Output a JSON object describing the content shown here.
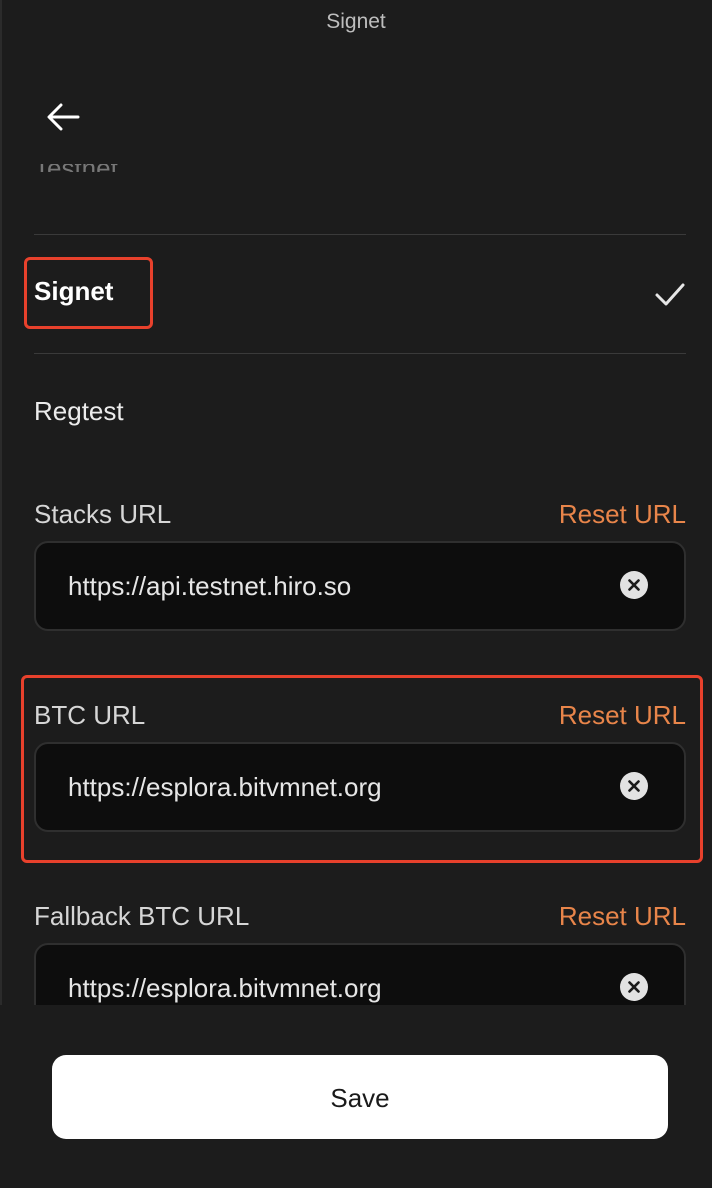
{
  "header": {
    "title": "Signet"
  },
  "icons": {
    "back": "arrow-left-icon",
    "check": "check-icon",
    "clear": "close-circle-icon"
  },
  "networks": {
    "hidden_label": "Testnet",
    "items": [
      {
        "label": "Signet",
        "selected": true
      },
      {
        "label": "Regtest",
        "selected": false
      }
    ]
  },
  "fields": [
    {
      "label": "Stacks URL",
      "reset_label": "Reset URL",
      "value": "https://api.testnet.hiro.so"
    },
    {
      "label": "BTC URL",
      "reset_label": "Reset URL",
      "value": "https://esplora.bitvmnet.org"
    },
    {
      "label": "Fallback BTC URL",
      "reset_label": "Reset URL",
      "value": "https://esplora.bitvmnet.org"
    }
  ],
  "footer": {
    "save_label": "Save"
  },
  "colors": {
    "background": "#1c1c1c",
    "accent": "#e8854a",
    "highlight": "#e8412c",
    "input_bg": "#0d0d0d"
  }
}
